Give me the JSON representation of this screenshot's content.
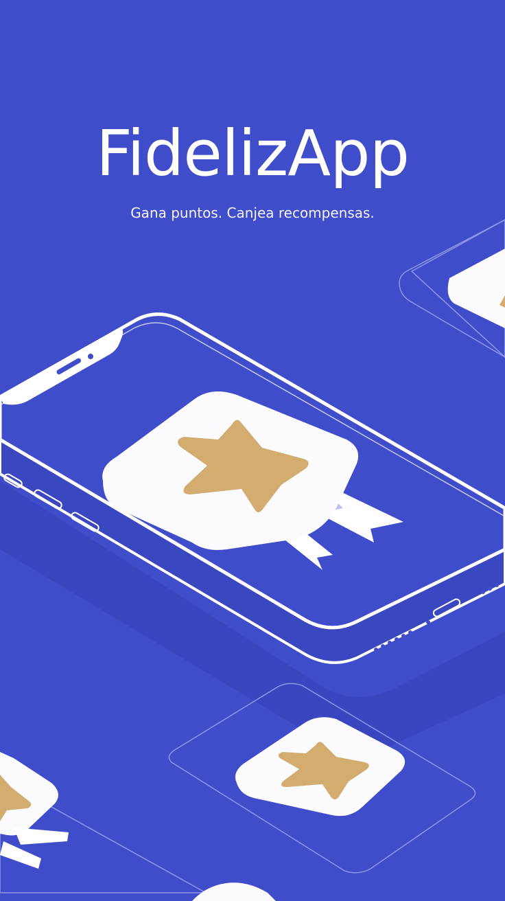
{
  "app": {
    "title": "FidelizApp",
    "tagline": "Gana puntos. Canjea recompensas."
  },
  "colors": {
    "background": "#3f4dcb",
    "phone_outline": "#ffffff",
    "screen": "#3f4dcb",
    "badge_fill": "#fbfbfd",
    "star": "#d3ad70",
    "ribbon": "#ffffff",
    "shadow": "#3540b3"
  },
  "icons": {
    "main_badge": "star-badge-icon",
    "secondary_badge": "star-badge-icon"
  }
}
